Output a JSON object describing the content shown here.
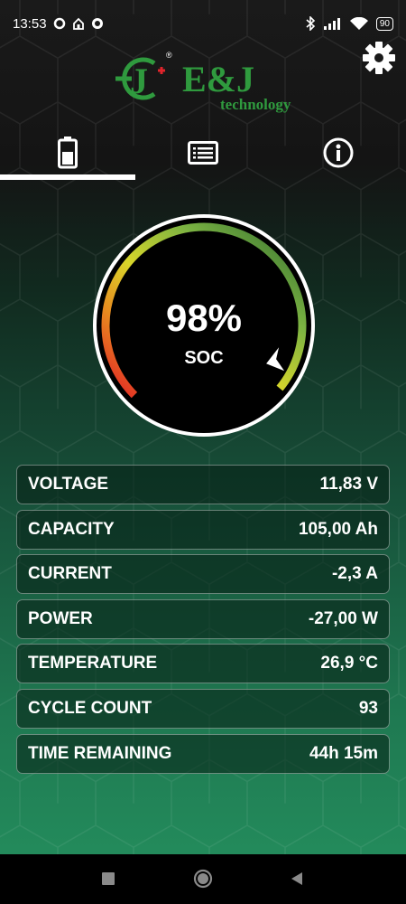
{
  "status_bar": {
    "time": "13:53",
    "battery": "90"
  },
  "logo": {
    "letter": "J",
    "name": "E&J",
    "tagline": "technology",
    "registered": "®"
  },
  "tabs": [
    {
      "icon": "battery-icon",
      "selected": true
    },
    {
      "icon": "list-icon",
      "selected": false
    },
    {
      "icon": "info-icon",
      "selected": false
    }
  ],
  "soc": {
    "value": "98%",
    "label": "SOC",
    "fraction": 0.98
  },
  "metrics": [
    {
      "label": "VOLTAGE",
      "value": "11,83 V"
    },
    {
      "label": "CAPACITY",
      "value": "105,00 Ah"
    },
    {
      "label": "CURRENT",
      "value": "-2,3 A"
    },
    {
      "label": "POWER",
      "value": "-27,00 W"
    },
    {
      "label": "TEMPERATURE",
      "value": "26,9 °C"
    },
    {
      "label": "CYCLE COUNT",
      "value": "93"
    },
    {
      "label": "TIME REMAINING",
      "value": "44h 15m"
    }
  ],
  "colors": {
    "accent_green": "#2f9a3e",
    "logo_red": "#e0242b",
    "gauge_red": "#e21f26",
    "gauge_yellow": "#d9d62a",
    "gauge_green": "#2e6b2f"
  }
}
